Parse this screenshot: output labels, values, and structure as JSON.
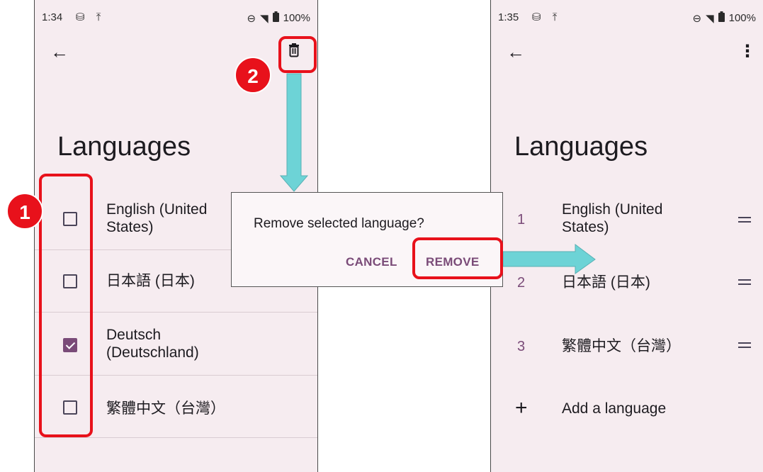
{
  "left_screen": {
    "status": {
      "time": "1:34",
      "icons": "⛁ ⤒",
      "dnd": "⊖",
      "wifi": "◥",
      "battery_level": "100%"
    },
    "title": "Languages",
    "languages": [
      {
        "label": "English (United States)",
        "checked": false
      },
      {
        "label": "日本語 (日本)",
        "checked": false
      },
      {
        "label": "Deutsch (Deutschland)",
        "checked": true
      },
      {
        "label": "繁體中文（台灣）",
        "checked": false
      }
    ]
  },
  "dialog": {
    "message": "Remove selected language?",
    "cancel_label": "CANCEL",
    "remove_label": "REMOVE"
  },
  "right_screen": {
    "status": {
      "time": "1:35",
      "icons": "⛁ ⤒",
      "dnd": "⊖",
      "wifi": "◥",
      "battery_level": "100%"
    },
    "title": "Languages",
    "languages": [
      {
        "num": "1",
        "label": "English (United States)"
      },
      {
        "num": "2",
        "label": "日本語 (日本)"
      },
      {
        "num": "3",
        "label": "繁體中文（台灣）"
      }
    ],
    "add_label": "Add a language"
  },
  "callouts": {
    "step1": "1",
    "step2": "2"
  },
  "colors": {
    "accent": "#7a4b78",
    "highlight": "#e8111b",
    "arrow": "#6dd3d6",
    "background": "#f6ecf0"
  },
  "icons": {
    "back": "arrow-back-icon",
    "trash": "trash-icon",
    "more": "more-vert-icon",
    "plus": "plus-icon",
    "drag": "drag-handle-icon"
  }
}
